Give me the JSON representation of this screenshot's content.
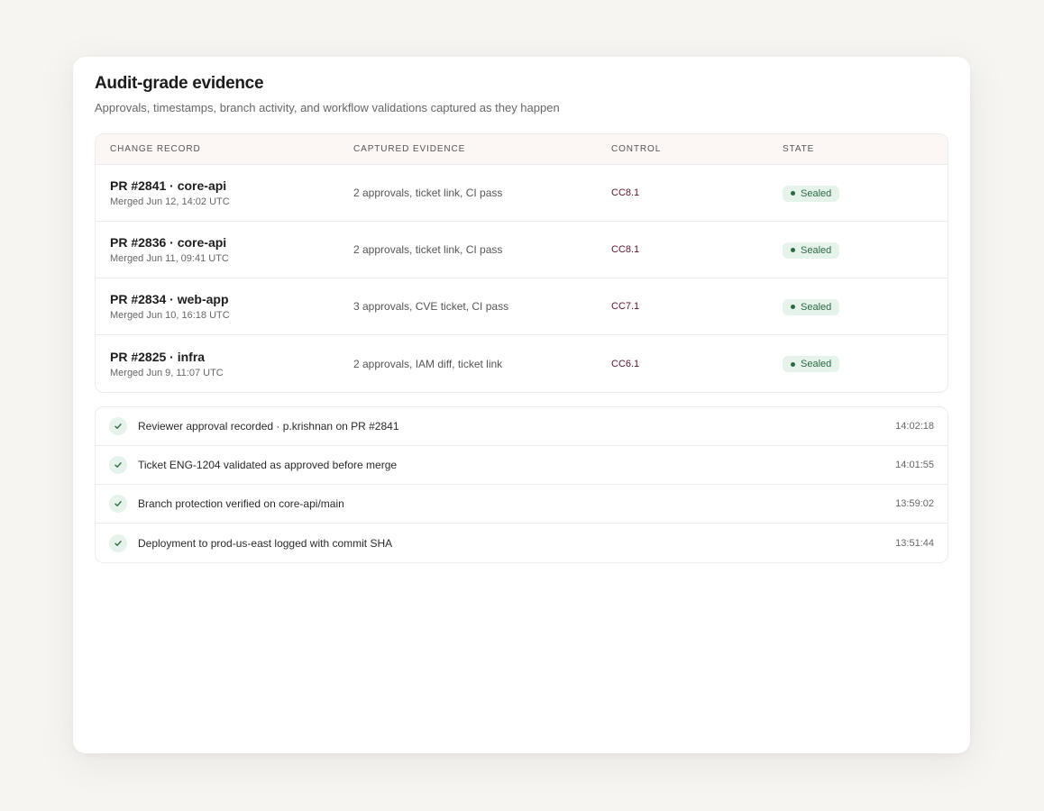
{
  "header": {
    "title": "Audit-grade evidence",
    "subtitle": "Approvals, timestamps, branch activity, and workflow validations captured as they happen"
  },
  "table": {
    "columns": [
      "CHANGE RECORD",
      "CAPTURED EVIDENCE",
      "CONTROL",
      "STATE"
    ],
    "rows": [
      {
        "title": "PR #2841 · core-api",
        "subtitle": "Merged Jun 12, 14:02 UTC",
        "evidence": "2 approvals, ticket link, CI pass",
        "control": "CC8.1",
        "state": "Sealed"
      },
      {
        "title": "PR #2836 · core-api",
        "subtitle": "Merged Jun 11, 09:41 UTC",
        "evidence": "2 approvals, ticket link, CI pass",
        "control": "CC8.1",
        "state": "Sealed"
      },
      {
        "title": "PR #2834 · web-app",
        "subtitle": "Merged Jun 10, 16:18 UTC",
        "evidence": "3 approvals, CVE ticket, CI pass",
        "control": "CC7.1",
        "state": "Sealed"
      },
      {
        "title": "PR #2825 · infra",
        "subtitle": "Merged Jun 9, 11:07 UTC",
        "evidence": "2 approvals, IAM diff, ticket link",
        "control": "CC6.1",
        "state": "Sealed"
      }
    ]
  },
  "log": {
    "items": [
      {
        "text": "Reviewer approval recorded · p.krishnan on PR #2841",
        "time": "14:02:18",
        "icon": "check-icon"
      },
      {
        "text": "Ticket ENG-1204 validated as approved before merge",
        "time": "14:01:55",
        "icon": "check-icon"
      },
      {
        "text": "Branch protection verified on core-api/main",
        "time": "13:59:02",
        "icon": "check-icon"
      },
      {
        "text": "Deployment to prod-us-east logged with commit SHA",
        "time": "13:51:44",
        "icon": "check-icon"
      }
    ]
  },
  "colors": {
    "background": "#f6f5f2",
    "header_bg": "#fcf7f4",
    "control_text": "#5a1330",
    "badge_bg": "#e6f3ea",
    "badge_text": "#2a6a40"
  }
}
